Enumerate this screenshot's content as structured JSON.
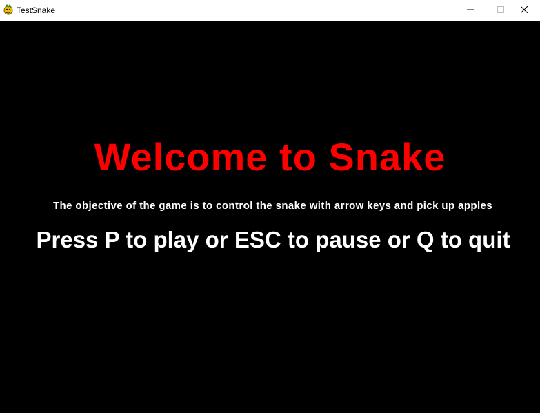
{
  "window": {
    "title": "TestSnake",
    "icon": "pygame-snake-icon",
    "controls": {
      "minimize_icon": "minimize-icon",
      "maximize_icon": "maximize-icon",
      "close_icon": "close-icon"
    }
  },
  "game": {
    "background_color": "#000000",
    "title": "Welcome to Snake",
    "title_color": "#ff0000",
    "objective": "The objective of the game is to control the snake with arrow keys and pick up apples",
    "objective_color": "#ffffff",
    "instructions": "Press P to play or ESC to pause or Q to quit",
    "instructions_color": "#ffffff"
  }
}
